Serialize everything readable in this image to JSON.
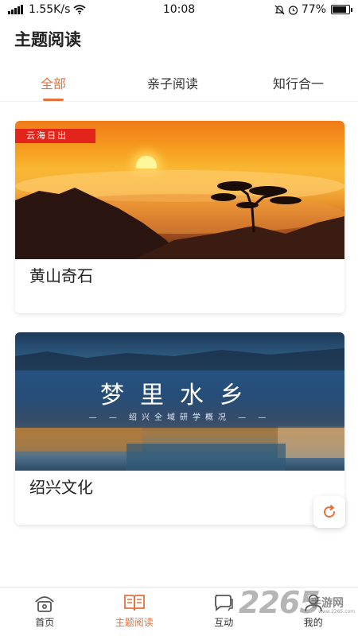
{
  "status_bar": {
    "network": "1.55K/s",
    "time": "10:08",
    "battery": "77%",
    "battery_level": 0.77
  },
  "header": {
    "title": "主题阅读"
  },
  "tabs": [
    {
      "label": "全部",
      "active": true
    },
    {
      "label": "亲子阅读",
      "active": false
    },
    {
      "label": "知行合一",
      "active": false
    }
  ],
  "cards": [
    {
      "title": "黄山奇石",
      "image_tag": "云海日出"
    },
    {
      "title": "绍兴文化",
      "banner_title": "梦里水乡",
      "banner_subtitle": "— — 绍兴全域研学概况 — —"
    }
  ],
  "bottom_nav": [
    {
      "label": "首页",
      "icon": "home-icon",
      "active": false
    },
    {
      "label": "主题阅读",
      "icon": "book-icon",
      "active": true
    },
    {
      "label": "互动",
      "icon": "chat-icon",
      "active": false
    },
    {
      "label": "我的",
      "icon": "user-icon",
      "active": false
    }
  ],
  "watermark": {
    "number": "2265",
    "text": "手游网",
    "url": "www.2265.com"
  },
  "colors": {
    "accent": "#e8703a",
    "tag_red": "#e3241b"
  }
}
